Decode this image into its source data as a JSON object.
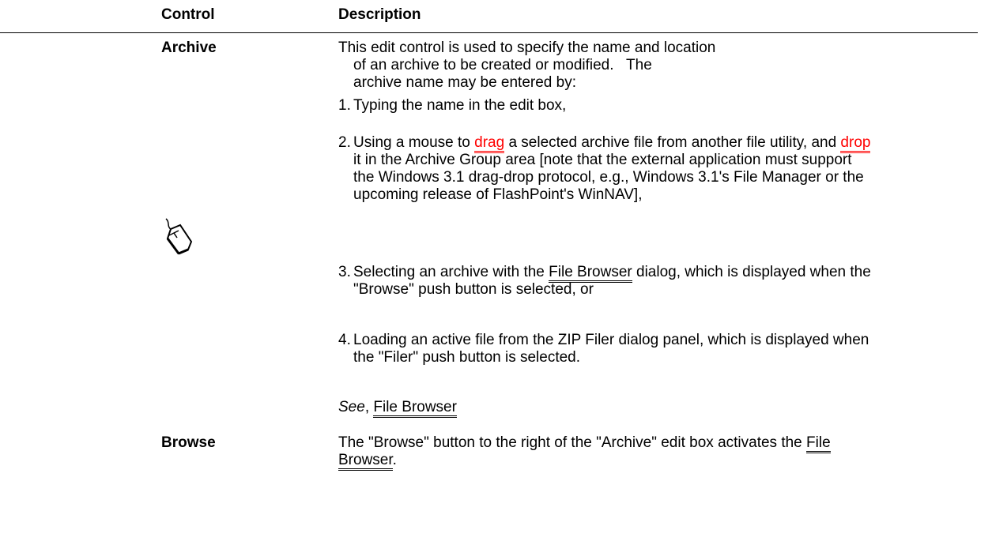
{
  "header": {
    "control_label": "Control",
    "description_label": "Description"
  },
  "rows": [
    {
      "term": "Archive",
      "intro_lines": [
        "This edit control is used to specify the name and location",
        "of an archive to be created or modified.   The",
        "archive name may be entered by:"
      ],
      "items": [
        {
          "number": "1.",
          "text": "Typing the name in the edit box,"
        },
        {
          "number": "2.",
          "text_a": "Using a mouse to ",
          "link_drag": "drag",
          "text_b": " a selected archive file from another file utility, and ",
          "link_drop": "drop",
          "text_c": " it in the Archive Group area [note that the external application must support the Windows 3.1 drag-drop protocol, e.g., Windows 3.1's File Manager or the upcoming release of FlashPoint's WinNAV],"
        },
        {
          "number": "3.",
          "text_a": "Selecting an archive with the ",
          "link": "File Browser",
          "text_b": " dialog, which is displayed when the \"Browse\" push button is selected, or"
        },
        {
          "number": "4.",
          "text": "Loading an active file from the ZIP Filer dialog panel, which is displayed when the \"Filer\" push button is selected."
        }
      ],
      "see_label": "See",
      "see_separator": ", ",
      "see_link": "File Browser"
    },
    {
      "term": "Browse",
      "text_a": "The \"Browse\" button to the right of the \"Archive\" edit box activates the ",
      "link": "File Browser",
      "text_b": "."
    }
  ],
  "icons": {
    "mouse": "mouse-icon"
  },
  "colors": {
    "popup_link": "#ff0000",
    "text": "#000000",
    "background": "#ffffff"
  }
}
